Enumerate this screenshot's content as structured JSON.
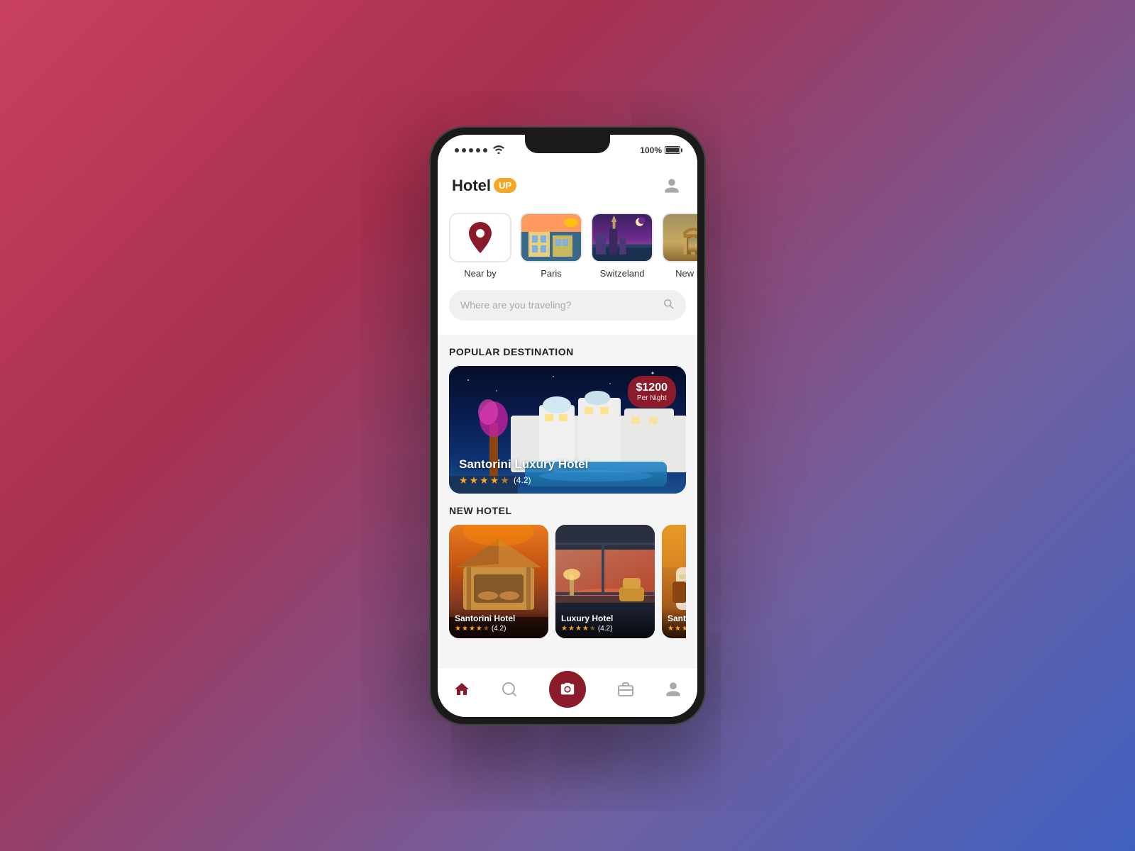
{
  "app": {
    "logo_text": "Hotel",
    "logo_badge": "UP",
    "status": {
      "battery": "100%",
      "signal_dots": 5
    }
  },
  "location_chips": [
    {
      "id": "nearby",
      "label": "Near by",
      "type": "icon"
    },
    {
      "id": "paris",
      "label": "Paris",
      "type": "image"
    },
    {
      "id": "switzerland",
      "label": "Switzeland",
      "type": "image"
    },
    {
      "id": "newdelhi",
      "label": "New D...",
      "type": "image"
    }
  ],
  "search": {
    "placeholder": "Where are you traveling?"
  },
  "popular": {
    "section_title": "POPULAR DESTINATION",
    "card": {
      "name": "Santorini Luxury Hotel",
      "price": "$1200",
      "price_label": "Per Night",
      "rating": "4.2",
      "stars": 4.2
    }
  },
  "new_hotel": {
    "section_title": "NEW HOTEL",
    "hotels": [
      {
        "name": "Santorini Hotel",
        "rating": "(4.2)",
        "stars": 4
      },
      {
        "name": "Luxury Hotel",
        "rating": "(4.2)",
        "stars": 4
      },
      {
        "name": "Santori...",
        "rating": "",
        "stars": 3
      }
    ]
  },
  "nav": {
    "items": [
      {
        "id": "home",
        "icon": "home-icon"
      },
      {
        "id": "search",
        "icon": "search-icon"
      },
      {
        "id": "camera",
        "icon": "camera-icon"
      },
      {
        "id": "bookings",
        "icon": "briefcase-icon"
      },
      {
        "id": "profile",
        "icon": "user-icon"
      }
    ]
  }
}
